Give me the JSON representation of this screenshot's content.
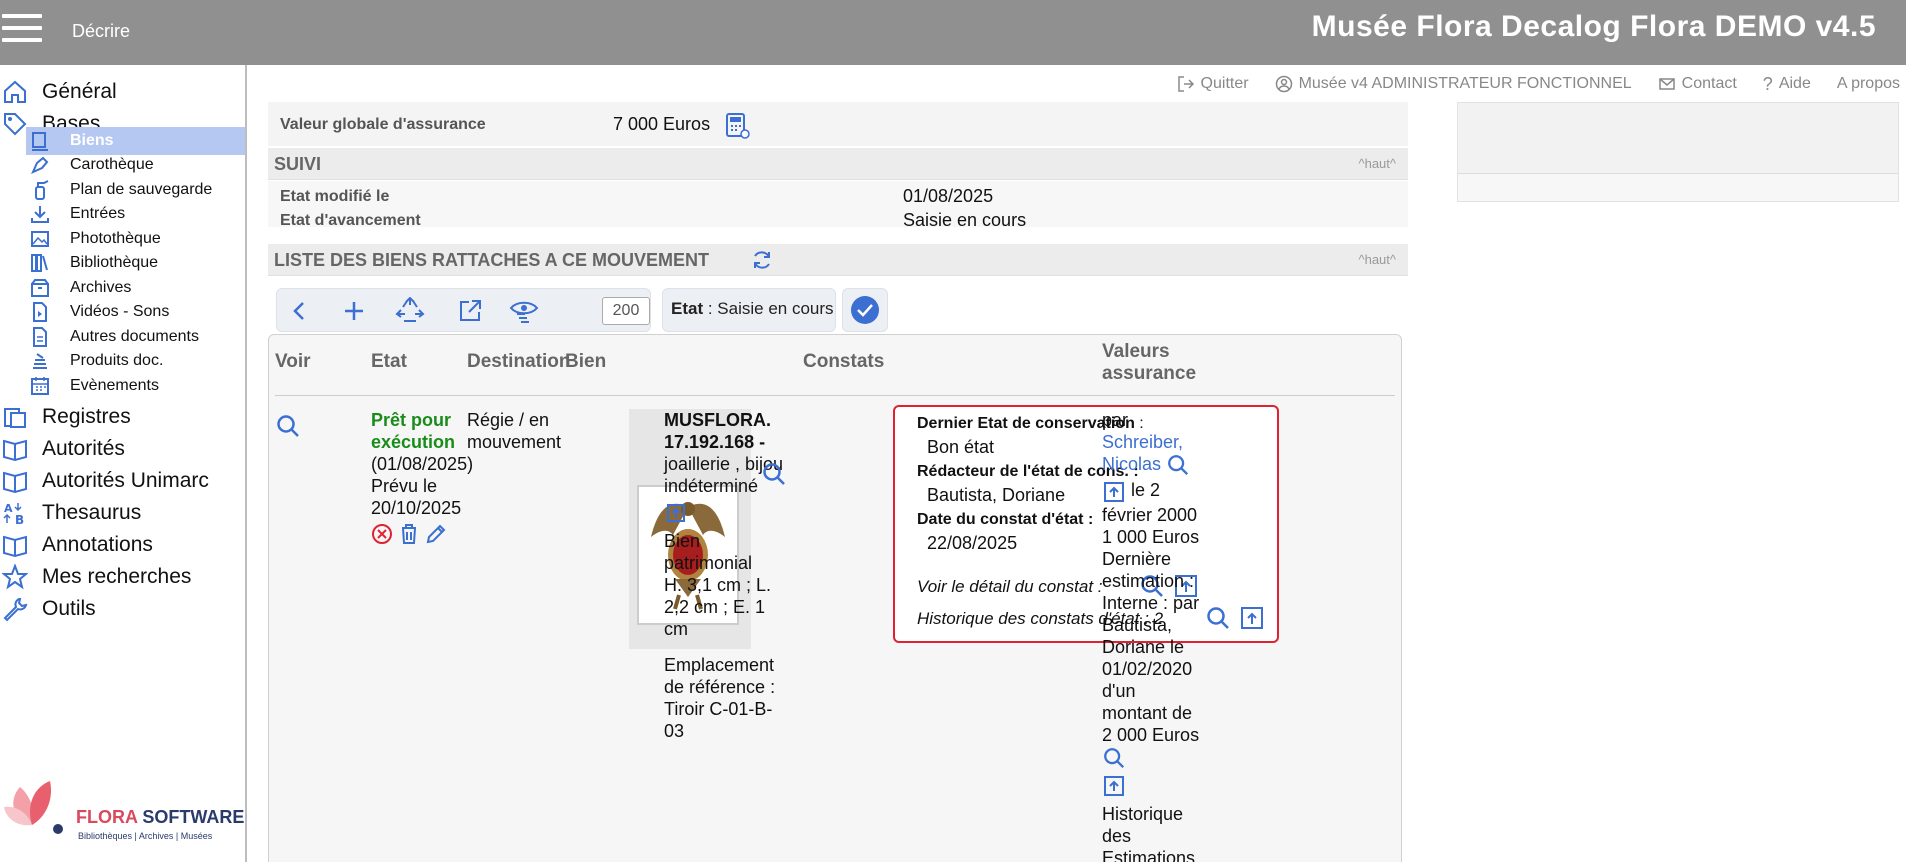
{
  "header": {
    "mode": "Décrire",
    "app_title": "Musée Flora Decalog Flora DEMO v4.5"
  },
  "colors": {
    "accent": "#3b6fd1",
    "danger": "#e0212f",
    "status_green": "#1a8c1a",
    "header_bg": "#909090"
  },
  "top_links": {
    "quit": "Quitter",
    "user": "Musée v4 ADMINISTRATEUR FONCTIONNEL",
    "contact": "Contact",
    "help": "Aide",
    "about": "A propos"
  },
  "nav": {
    "general": "Général",
    "bases": "Bases",
    "subitems": [
      "Biens",
      "Carothèque",
      "Plan de sauvegarde",
      "Entrées",
      "Photothèque",
      "Bibliothèque",
      "Archives",
      "Vidéos - Sons",
      "Autres documents",
      "Produits doc.",
      "Evènements"
    ],
    "registres": "Registres",
    "autorites": "Autorités",
    "autorites_unimarc": "Autorités Unimarc",
    "thesaurus": "Thesaurus",
    "annotations": "Annotations",
    "mes_recherches": "Mes recherches",
    "outils": "Outils"
  },
  "logo": {
    "brand_a": "FLORA",
    "brand_b": " SOFTWARE",
    "tagline": "Bibliothèques | Archives | Musées"
  },
  "insurance": {
    "label": "Valeur globale d'assurance",
    "value": "7 000 Euros"
  },
  "suivi": {
    "title": "SUIVI",
    "top_link": "^haut^",
    "modified_label": "Etat modifié le",
    "modified_value": "01/08/2025",
    "progress_label": "Etat d'avancement",
    "progress_value": "Saisie en cours"
  },
  "liste": {
    "title": "LISTE DES BIENS RATTACHES A CE MOUVEMENT",
    "top_link": "^haut^"
  },
  "toolbar": {
    "page_size": "200",
    "etat_label": "Etat",
    "etat_value": " : Saisie en cours"
  },
  "table": {
    "headers": {
      "voir": "Voir",
      "etat": "Etat",
      "destination": "Destination",
      "bien": "Bien",
      "constats": "Constats",
      "valeurs": "Valeurs assurance"
    },
    "row": {
      "status": "Prêt pour exécution",
      "status_date": "(01/08/2025)",
      "planned": "Prévu le 20/10/2025",
      "destination": "Régie / en mouvement",
      "bien_id": "MUSFLORA. 17.192.168 -",
      "bien_type": "joaillerie , bijou indéterminé",
      "bien_kind": "Bien patrimonial",
      "bien_dims": "H. 3,1 cm ; L. 2,2 cm ; E. 1 cm",
      "bien_location": "Emplacement de référence : Tiroir C-01-B-03",
      "constat": {
        "state_label": "Dernier Etat de conservation",
        "state_suffix": " :",
        "state_value": "Bon état",
        "author_label": "Rédacteur de l'état de cons. :",
        "author_value": "Bautista, Doriane",
        "date_label": "Date du constat d'état :",
        "date_value": "22/08/2025",
        "detail_label": "Voir le détail du constat :",
        "history_label": "Historique des constats d'état : 2"
      },
      "valeurs": {
        "par": "par",
        "author_link": "Schreiber, Nicolas",
        "date_text": "le 2 février 2000",
        "amount": "1 000 Euros",
        "last_estimate": "Dernière estimation : Interne : par Bautista, Doriane le 01/02/2020 d'un montant de 2 000 Euros",
        "history": "Historique des Estimations :"
      }
    }
  }
}
